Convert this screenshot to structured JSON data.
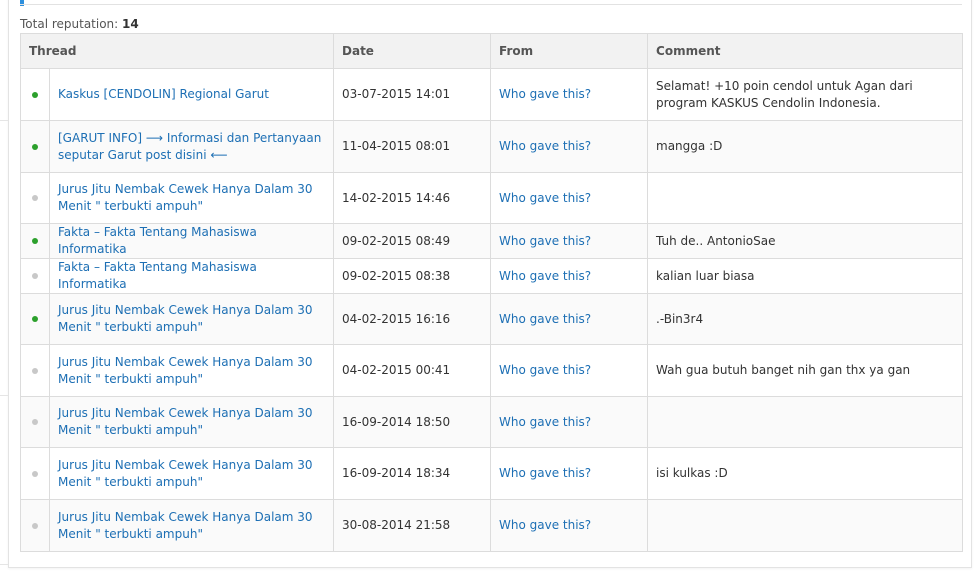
{
  "summary": {
    "label": "Total reputation:",
    "value": "14"
  },
  "table": {
    "headers": {
      "thread": "Thread",
      "date": "Date",
      "from": "From",
      "comment": "Comment"
    },
    "rows": [
      {
        "status": "positive",
        "thread": "Kaskus [CENDOLIN] Regional Garut",
        "date": "03-07-2015 14:01",
        "from": "Who gave this?",
        "comment": "Selamat! +10 poin cendol untuk Agan dari program KASKUS Cendolin Indonesia."
      },
      {
        "status": "positive",
        "thread": "[GARUT INFO] ⟶ Informasi dan Pertanyaan seputar Garut post disini ⟵",
        "date": "11-04-2015 08:01",
        "from": "Who gave this?",
        "comment": "mangga :D"
      },
      {
        "status": "neutral",
        "thread": "Jurus Jitu Nembak Cewek Hanya Dalam 30 Menit \" terbukti ampuh\"",
        "date": "14-02-2015 14:46",
        "from": "Who gave this?",
        "comment": ""
      },
      {
        "status": "positive",
        "thread": "Fakta – Fakta Tentang Mahasiswa Informatika",
        "date": "09-02-2015 08:49",
        "from": "Who gave this?",
        "comment": "Tuh de.. AntonioSae"
      },
      {
        "status": "neutral",
        "thread": "Fakta – Fakta Tentang Mahasiswa Informatika",
        "date": "09-02-2015 08:38",
        "from": "Who gave this?",
        "comment": "kalian luar biasa"
      },
      {
        "status": "positive",
        "thread": "Jurus Jitu Nembak Cewek Hanya Dalam 30 Menit \" terbukti ampuh\"",
        "date": "04-02-2015 16:16",
        "from": "Who gave this?",
        "comment": ".-Bin3r4"
      },
      {
        "status": "neutral",
        "thread": "Jurus Jitu Nembak Cewek Hanya Dalam 30 Menit \" terbukti ampuh\"",
        "date": "04-02-2015 00:41",
        "from": "Who gave this?",
        "comment": "Wah gua butuh banget nih gan thx ya gan"
      },
      {
        "status": "neutral",
        "thread": "Jurus Jitu Nembak Cewek Hanya Dalam 30 Menit \" terbukti ampuh\"",
        "date": "16-09-2014 18:50",
        "from": "Who gave this?",
        "comment": ""
      },
      {
        "status": "neutral",
        "thread": "Jurus Jitu Nembak Cewek Hanya Dalam 30 Menit \" terbukti ampuh\"",
        "date": "16-09-2014 18:34",
        "from": "Who gave this?",
        "comment": "isi kulkas :D"
      },
      {
        "status": "neutral",
        "thread": "Jurus Jitu Nembak Cewek Hanya Dalam 30 Menit \" terbukti ampuh\"",
        "date": "30-08-2014 21:58",
        "from": "Who gave this?",
        "comment": ""
      }
    ]
  },
  "colors": {
    "positive_dot": "#2ca02c",
    "neutral_dot": "#c8c8c8",
    "link": "#1d6fb4",
    "header_bg": "#f2f2f2",
    "accent": "#2d8fdd"
  }
}
